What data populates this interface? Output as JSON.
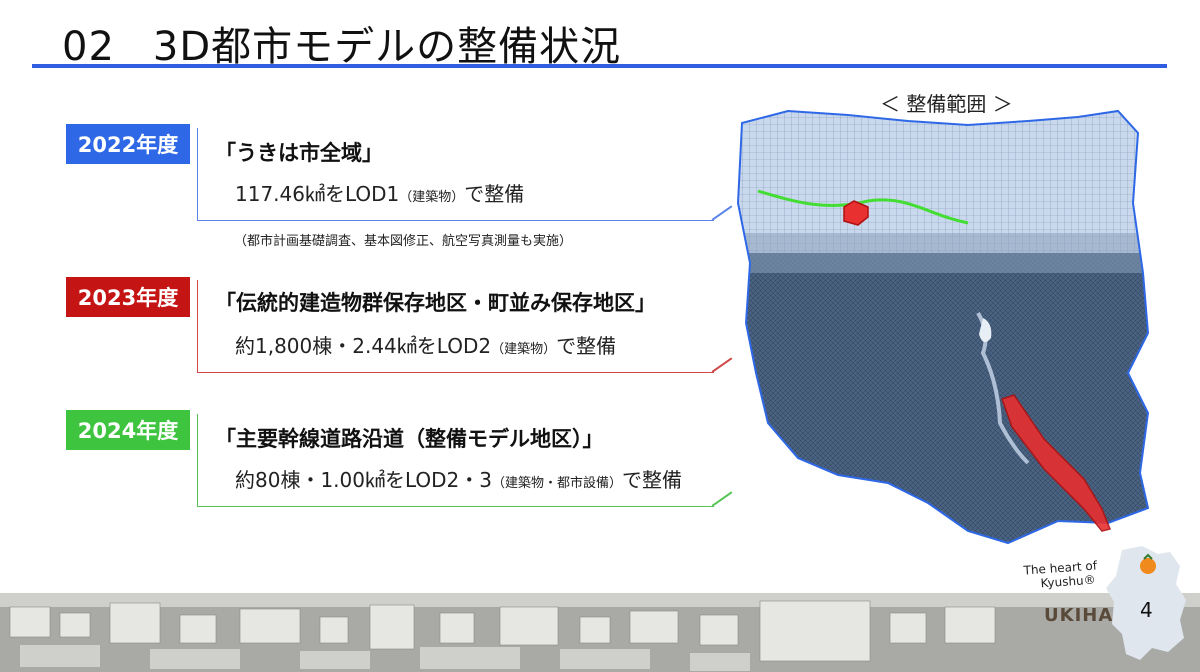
{
  "slide": {
    "number": "02",
    "title": "3D都市モデルの整備状況",
    "page_number": "4"
  },
  "sections": [
    {
      "year": "2022年度",
      "heading": "「うきは市全域」",
      "detail_main": "117.46㎢をLOD1",
      "detail_small": "（建築物）",
      "detail_end": "で整備",
      "note": "（都市計画基礎調査、基本図修正、航空写真測量も実施）",
      "color": "#2f68e6"
    },
    {
      "year": "2023年度",
      "heading": "「伝統的建造物群保存地区・町並み保存地区」",
      "detail_main": "約1,800棟・2.44㎢をLOD2",
      "detail_small": "（建築物）",
      "detail_end": "で整備",
      "color": "#c51414"
    },
    {
      "year": "2024年度",
      "heading": "「主要幹線道路沿道（整備モデル地区）」",
      "detail_main": "約80棟・1.00㎢をLOD2・3",
      "detail_small": "（建築物・都市設備）",
      "detail_end": "で整備",
      "color": "#3ec43e"
    }
  ],
  "map": {
    "caption": "＜ 整備範囲 ＞"
  },
  "logo": {
    "tagline_1": "The heart of",
    "tagline_2": "Kyushu®",
    "wordmark": "UKIHA"
  }
}
